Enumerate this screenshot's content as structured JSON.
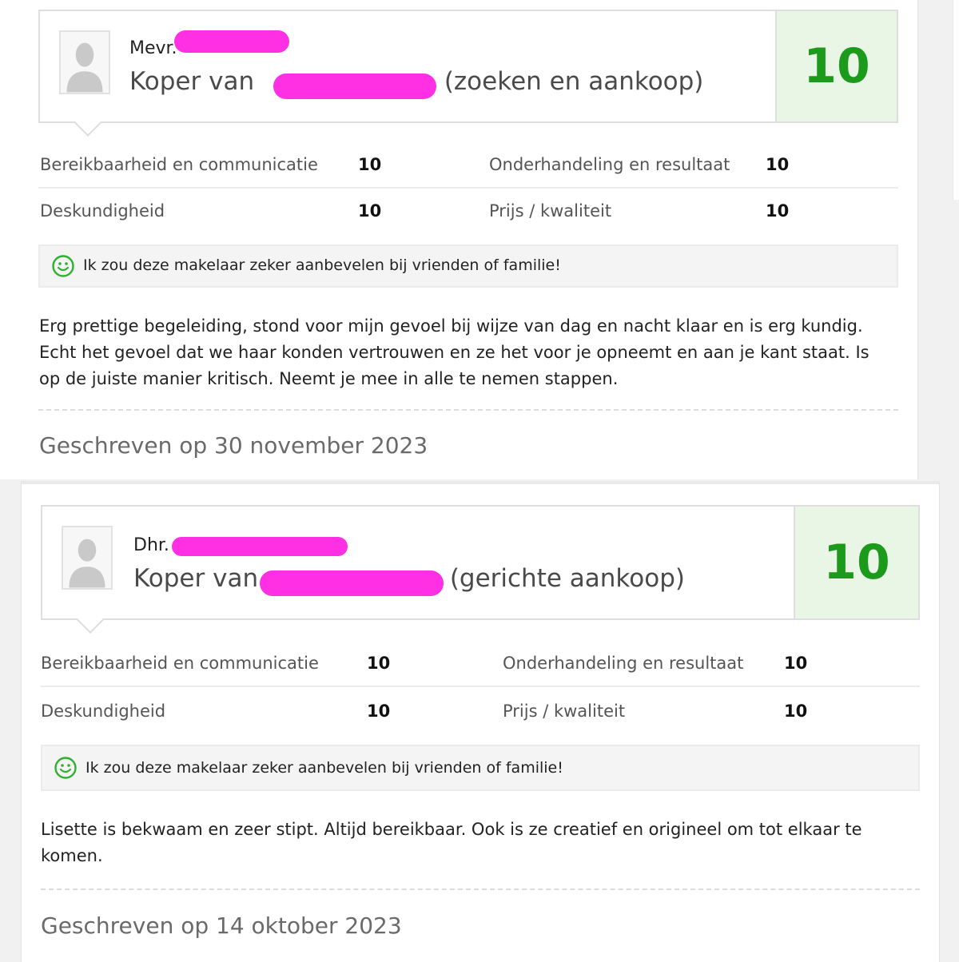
{
  "reviews": [
    {
      "reviewer_prefix": "Mevr.",
      "koper_prefix": "Koper van",
      "koper_suffix": "(zoeken en aankoop)",
      "overall_score": "10",
      "ratings": [
        {
          "label": "Bereikbaarheid en communicatie",
          "value": "10"
        },
        {
          "label": "Onderhandeling en resultaat",
          "value": "10"
        },
        {
          "label": "Deskundigheid",
          "value": "10"
        },
        {
          "label": "Prijs / kwaliteit",
          "value": "10"
        }
      ],
      "recommendation": "Ik zou deze makelaar zeker aanbevelen bij vrienden of familie!",
      "text": "Erg prettige begeleiding, stond voor mijn gevoel bij wijze van dag en nacht klaar en is erg kundig. Echt het gevoel dat we haar konden vertrouwen en ze het voor je opneemt en aan je kant staat. Is op de juiste manier kritisch. Neemt je mee in alle te nemen stappen.",
      "written": "Geschreven op 30 november 2023"
    },
    {
      "reviewer_prefix": "Dhr.",
      "koper_prefix": "Koper van",
      "koper_suffix": "(gerichte aankoop)",
      "overall_score": "10",
      "ratings": [
        {
          "label": "Bereikbaarheid en communicatie",
          "value": "10"
        },
        {
          "label": "Onderhandeling en resultaat",
          "value": "10"
        },
        {
          "label": "Deskundigheid",
          "value": "10"
        },
        {
          "label": "Prijs / kwaliteit",
          "value": "10"
        }
      ],
      "recommendation": "Ik zou deze makelaar zeker aanbevelen bij vrienden of familie!",
      "text": "Lisette is bekwaam en zeer stipt. Altijd bereikbaar. Ook is ze creatief en origineel om tot elkaar te komen.",
      "written": "Geschreven op 14 oktober 2023"
    }
  ],
  "colors": {
    "score_green": "#1c9a1c",
    "score_bg": "#e9f5e5",
    "redaction": "#ff2fe3",
    "smiley_green": "#2fb02f"
  },
  "icons": {
    "avatar": "person-silhouette-icon",
    "recommend": "smiley-icon"
  }
}
